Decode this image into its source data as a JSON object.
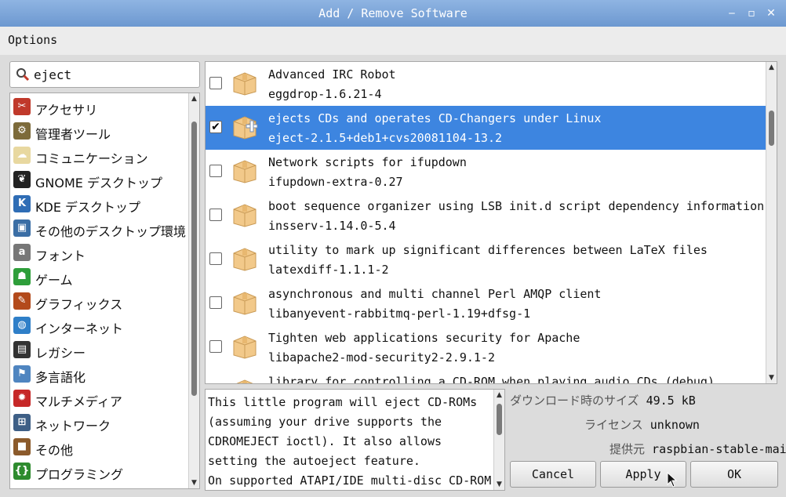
{
  "window": {
    "title": "Add / Remove Software"
  },
  "menu": {
    "options": "Options"
  },
  "search": {
    "value": "eject"
  },
  "categories": [
    {
      "label": "アクセサリ",
      "icon": "accessories-icon",
      "color": "#c0392b"
    },
    {
      "label": "管理者ツール",
      "icon": "admin-tools-icon",
      "color": "#7d6b3a"
    },
    {
      "label": "コミュニケーション",
      "icon": "communication-icon",
      "color": "#e8d8a0"
    },
    {
      "label": "GNOME デスクトップ",
      "icon": "gnome-foot-icon",
      "color": "#222222"
    },
    {
      "label": "KDE デスクトップ",
      "icon": "kde-icon",
      "color": "#2f6db5"
    },
    {
      "label": "その他のデスクトップ環境",
      "icon": "desktop-icon",
      "color": "#3b6ea5"
    },
    {
      "label": "フォント",
      "icon": "font-icon",
      "color": "#777777"
    },
    {
      "label": "ゲーム",
      "icon": "game-invader-icon",
      "color": "#2e9e3a"
    },
    {
      "label": "グラフィックス",
      "icon": "paintbrush-icon",
      "color": "#b34a1b"
    },
    {
      "label": "インターネット",
      "icon": "globe-icon",
      "color": "#2f7fc8"
    },
    {
      "label": "レガシー",
      "icon": "floppy-icon",
      "color": "#333333"
    },
    {
      "label": "多言語化",
      "icon": "localization-flag-icon",
      "color": "#4f85c0"
    },
    {
      "label": "マルチメディア",
      "icon": "popcorn-icon",
      "color": "#c62828"
    },
    {
      "label": "ネットワーク",
      "icon": "network-icon",
      "color": "#3e5f86"
    },
    {
      "label": "その他",
      "icon": "box-icon",
      "color": "#8b5a2b"
    },
    {
      "label": "プログラミング",
      "icon": "programming-icon",
      "color": "#2e8b2e"
    }
  ],
  "packages": [
    {
      "summary": "Advanced IRC Robot",
      "name": "eggdrop-1.6.21-4",
      "checked": false,
      "selected": false
    },
    {
      "summary": "ejects CDs and operates CD-Changers under Linux",
      "name": "eject-2.1.5+deb1+cvs20081104-13.2",
      "checked": true,
      "selected": true
    },
    {
      "summary": "Network scripts for ifupdown",
      "name": "ifupdown-extra-0.27",
      "checked": false,
      "selected": false
    },
    {
      "summary": "boot sequence organizer using LSB init.d script dependency information",
      "name": "insserv-1.14.0-5.4",
      "checked": false,
      "selected": false
    },
    {
      "summary": "utility to mark up significant differences between LaTeX files",
      "name": "latexdiff-1.1.1-2",
      "checked": false,
      "selected": false
    },
    {
      "summary": "asynchronous and multi channel Perl AMQP client",
      "name": "libanyevent-rabbitmq-perl-1.19+dfsg-1",
      "checked": false,
      "selected": false
    },
    {
      "summary": "Tighten web applications security for Apache",
      "name": "libapache2-mod-security2-2.9.1-2",
      "checked": false,
      "selected": false
    },
    {
      "summary": "library for controlling a CD-ROM when playing audio CDs (debug)",
      "name": "",
      "checked": false,
      "selected": false
    }
  ],
  "description": "This little program will eject CD-ROMs (assuming your drive supports the CDROMEJECT ioctl). It also allows setting the autoeject feature.\nOn supported ATAPI/IDE multi-disc CD-ROM",
  "details": {
    "download_size_label": "ダウンロード時のサイズ",
    "download_size_value": "49.5 kB",
    "license_label": "ライセンス",
    "license_value": "unknown",
    "provider_label": "提供元",
    "provider_value": "raspbian-stable-main"
  },
  "buttons": {
    "cancel": "Cancel",
    "apply": "Apply",
    "ok": "OK"
  },
  "colors": {
    "titlebar": "#7aa3d8",
    "selection": "#3d85e0"
  }
}
